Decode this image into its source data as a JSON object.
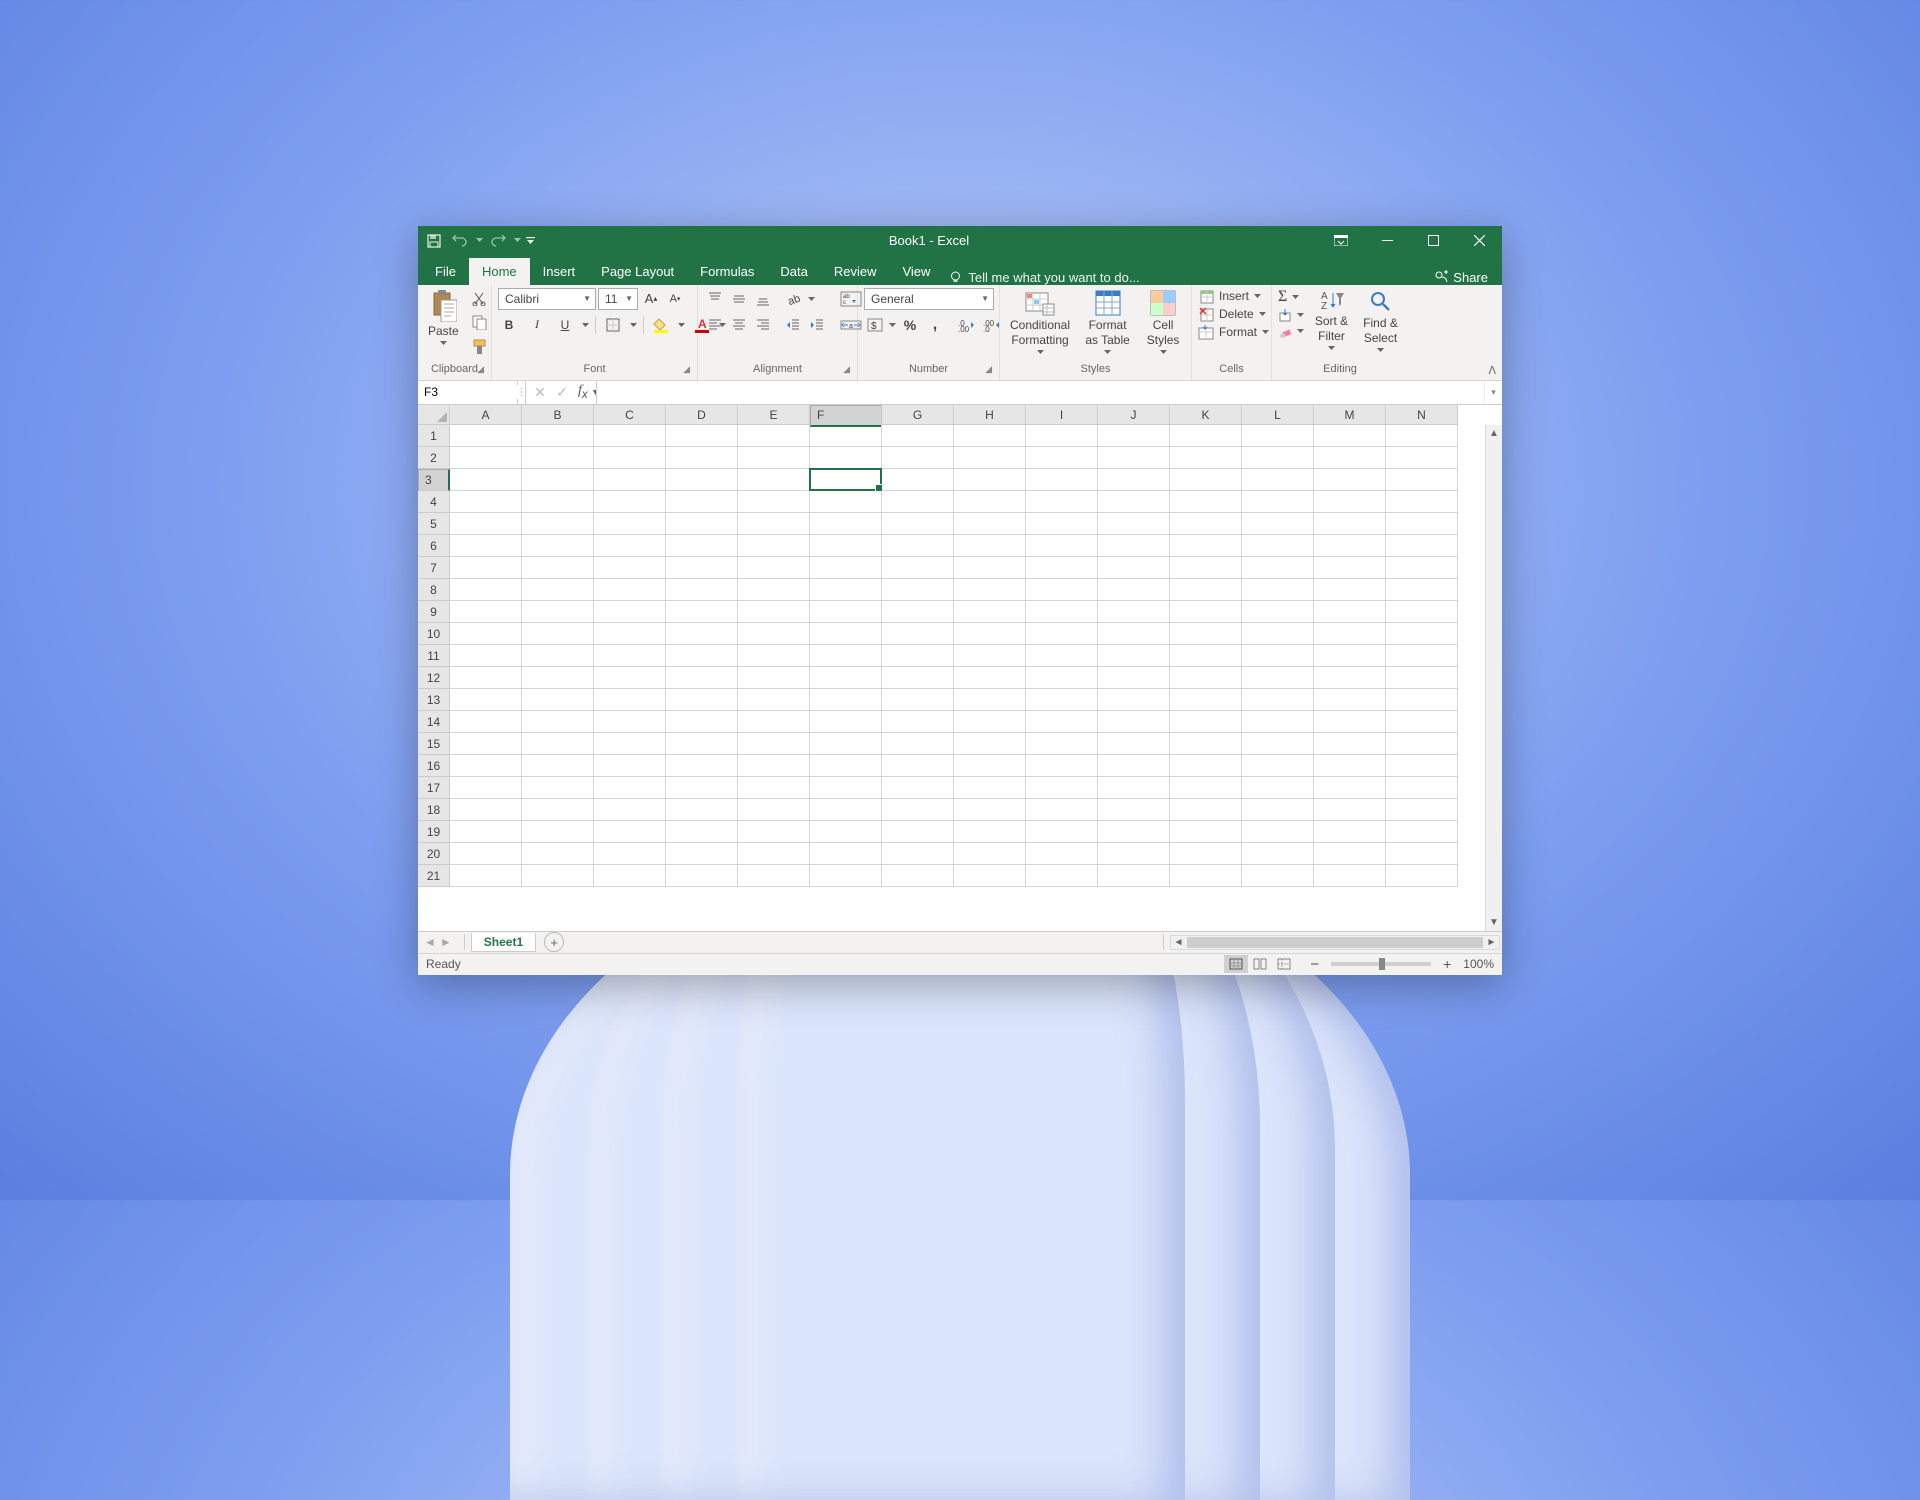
{
  "title": "Book1 - Excel",
  "qat": {
    "save": "save-icon",
    "undo": "undo-icon",
    "redo": "redo-icon"
  },
  "tabs": {
    "file": "File",
    "home": "Home",
    "insert": "Insert",
    "pageLayout": "Page Layout",
    "formulas": "Formulas",
    "data": "Data",
    "review": "Review",
    "view": "View",
    "active": "home"
  },
  "tellme": "Tell me what you want to do...",
  "share": "Share",
  "ribbon": {
    "clipboard": {
      "label": "Clipboard",
      "paste": "Paste"
    },
    "font": {
      "label": "Font",
      "name": "Calibri",
      "size": "11"
    },
    "alignment": {
      "label": "Alignment"
    },
    "number": {
      "label": "Number",
      "format": "General"
    },
    "styles": {
      "label": "Styles",
      "cond": "Conditional Formatting",
      "table": "Format as Table",
      "cell": "Cell Styles"
    },
    "cells": {
      "label": "Cells",
      "insert": "Insert",
      "delete": "Delete",
      "format": "Format"
    },
    "editing": {
      "label": "Editing",
      "sort": "Sort & Filter",
      "find": "Find & Select"
    }
  },
  "namebox": "F3",
  "formula": "",
  "columns": [
    "A",
    "B",
    "C",
    "D",
    "E",
    "F",
    "G",
    "H",
    "I",
    "J",
    "K",
    "L",
    "M",
    "N"
  ],
  "rows": [
    1,
    2,
    3,
    4,
    5,
    6,
    7,
    8,
    9,
    10,
    11,
    12,
    13,
    14,
    15,
    16,
    17,
    18,
    19,
    20,
    21
  ],
  "activeCol": "F",
  "activeRow": 3,
  "sheet": "Sheet1",
  "status": "Ready",
  "zoom": "100%"
}
